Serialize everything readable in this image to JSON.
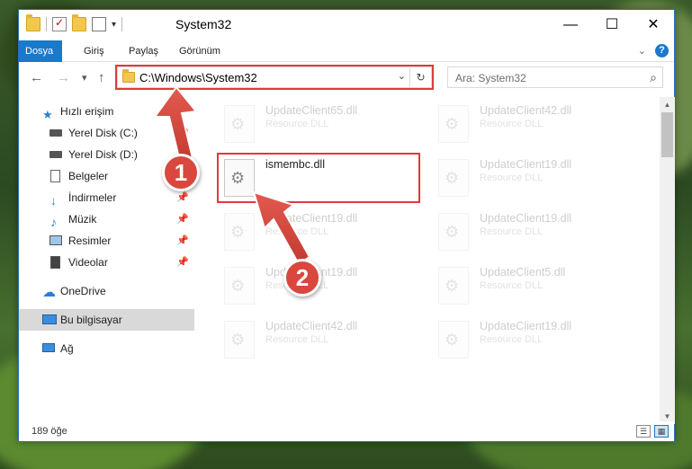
{
  "window": {
    "title": "System32",
    "controls": {
      "minimize": "—",
      "maximize": "☐",
      "close": "✕"
    }
  },
  "ribbon": {
    "tabs": [
      "Dosya",
      "Giriş",
      "Paylaş",
      "Görünüm"
    ],
    "active_tab": "Dosya",
    "help": "?"
  },
  "nav": {
    "back": "←",
    "forward": "→",
    "recent": "▾",
    "up": "↑",
    "address": "C:\\Windows\\System32",
    "search_placeholder": "Ara: System32"
  },
  "sidebar": {
    "items": [
      {
        "label": "Hızlı erişim",
        "icon": "star-icon",
        "pinned": false
      },
      {
        "label": "Yerel Disk (C:)",
        "icon": "drive-icon",
        "pinned": true
      },
      {
        "label": "Yerel Disk (D:)",
        "icon": "drive-icon",
        "pinned": true
      },
      {
        "label": "Belgeler",
        "icon": "documents-icon",
        "pinned": true
      },
      {
        "label": "İndirmeler",
        "icon": "download-icon",
        "pinned": true
      },
      {
        "label": "Müzik",
        "icon": "music-icon",
        "pinned": true
      },
      {
        "label": "Resimler",
        "icon": "pictures-icon",
        "pinned": true
      },
      {
        "label": "Videolar",
        "icon": "videos-icon",
        "pinned": true
      },
      {
        "label": "OneDrive",
        "icon": "cloud-icon",
        "pinned": false
      },
      {
        "label": "Bu bilgisayar",
        "icon": "computer-icon",
        "pinned": false,
        "selected": true
      },
      {
        "label": "Ağ",
        "icon": "network-icon",
        "pinned": false
      }
    ],
    "pin_glyph": "📌"
  },
  "files": [
    {
      "name": "UpdateClient65.dll",
      "type": "Resource DLL",
      "faded": true
    },
    {
      "name": "UpdateClient42.dll",
      "type": "Resource DLL",
      "faded": true
    },
    {
      "name": "ismembc.dll",
      "type": "",
      "faded": false,
      "highlighted": true
    },
    {
      "name": "UpdateClient19.dll",
      "type": "Resource DLL",
      "faded": true
    },
    {
      "name": "UpdateClient19.dll",
      "type": "Resource DLL",
      "faded": true
    },
    {
      "name": "UpdateClient19.dll",
      "type": "Resource DLL",
      "faded": true
    },
    {
      "name": "UpdateClient19.dll",
      "type": "Resource DLL",
      "faded": true
    },
    {
      "name": "UpdateClient5.dll",
      "type": "Resource DLL",
      "faded": true
    },
    {
      "name": "UpdateClient42.dll",
      "type": "Resource DLL",
      "faded": true
    },
    {
      "name": "UpdateClient19.dll",
      "type": "Resource DLL",
      "faded": true
    }
  ],
  "status": {
    "item_count": "189 öğe"
  },
  "callouts": [
    "1",
    "2"
  ],
  "colors": {
    "accent": "#1979ca",
    "highlight": "#e03a3a",
    "callout": "#d9473e"
  }
}
